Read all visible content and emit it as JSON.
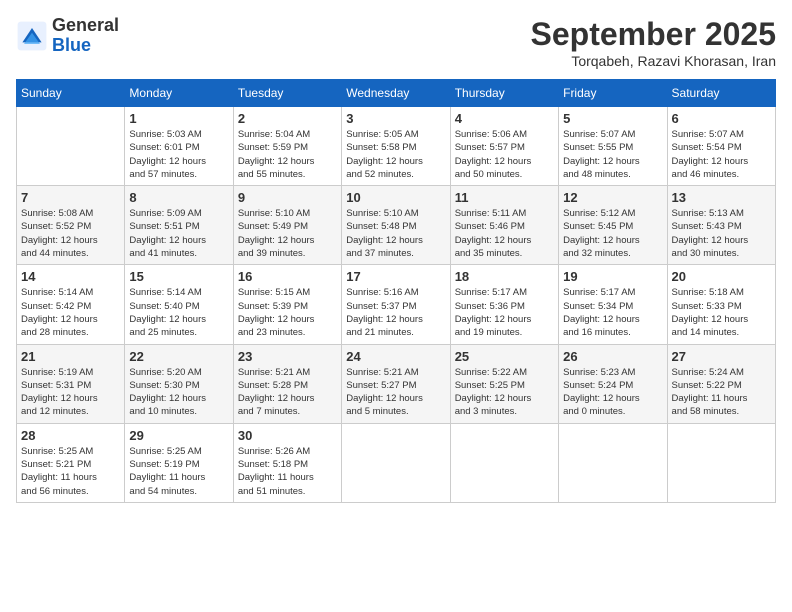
{
  "header": {
    "logo_line1": "General",
    "logo_line2": "Blue",
    "month_title": "September 2025",
    "subtitle": "Torqabeh, Razavi Khorasan, Iran"
  },
  "weekdays": [
    "Sunday",
    "Monday",
    "Tuesday",
    "Wednesday",
    "Thursday",
    "Friday",
    "Saturday"
  ],
  "weeks": [
    [
      {
        "day": "",
        "info": ""
      },
      {
        "day": "1",
        "info": "Sunrise: 5:03 AM\nSunset: 6:01 PM\nDaylight: 12 hours\nand 57 minutes."
      },
      {
        "day": "2",
        "info": "Sunrise: 5:04 AM\nSunset: 5:59 PM\nDaylight: 12 hours\nand 55 minutes."
      },
      {
        "day": "3",
        "info": "Sunrise: 5:05 AM\nSunset: 5:58 PM\nDaylight: 12 hours\nand 52 minutes."
      },
      {
        "day": "4",
        "info": "Sunrise: 5:06 AM\nSunset: 5:57 PM\nDaylight: 12 hours\nand 50 minutes."
      },
      {
        "day": "5",
        "info": "Sunrise: 5:07 AM\nSunset: 5:55 PM\nDaylight: 12 hours\nand 48 minutes."
      },
      {
        "day": "6",
        "info": "Sunrise: 5:07 AM\nSunset: 5:54 PM\nDaylight: 12 hours\nand 46 minutes."
      }
    ],
    [
      {
        "day": "7",
        "info": "Sunrise: 5:08 AM\nSunset: 5:52 PM\nDaylight: 12 hours\nand 44 minutes."
      },
      {
        "day": "8",
        "info": "Sunrise: 5:09 AM\nSunset: 5:51 PM\nDaylight: 12 hours\nand 41 minutes."
      },
      {
        "day": "9",
        "info": "Sunrise: 5:10 AM\nSunset: 5:49 PM\nDaylight: 12 hours\nand 39 minutes."
      },
      {
        "day": "10",
        "info": "Sunrise: 5:10 AM\nSunset: 5:48 PM\nDaylight: 12 hours\nand 37 minutes."
      },
      {
        "day": "11",
        "info": "Sunrise: 5:11 AM\nSunset: 5:46 PM\nDaylight: 12 hours\nand 35 minutes."
      },
      {
        "day": "12",
        "info": "Sunrise: 5:12 AM\nSunset: 5:45 PM\nDaylight: 12 hours\nand 32 minutes."
      },
      {
        "day": "13",
        "info": "Sunrise: 5:13 AM\nSunset: 5:43 PM\nDaylight: 12 hours\nand 30 minutes."
      }
    ],
    [
      {
        "day": "14",
        "info": "Sunrise: 5:14 AM\nSunset: 5:42 PM\nDaylight: 12 hours\nand 28 minutes."
      },
      {
        "day": "15",
        "info": "Sunrise: 5:14 AM\nSunset: 5:40 PM\nDaylight: 12 hours\nand 25 minutes."
      },
      {
        "day": "16",
        "info": "Sunrise: 5:15 AM\nSunset: 5:39 PM\nDaylight: 12 hours\nand 23 minutes."
      },
      {
        "day": "17",
        "info": "Sunrise: 5:16 AM\nSunset: 5:37 PM\nDaylight: 12 hours\nand 21 minutes."
      },
      {
        "day": "18",
        "info": "Sunrise: 5:17 AM\nSunset: 5:36 PM\nDaylight: 12 hours\nand 19 minutes."
      },
      {
        "day": "19",
        "info": "Sunrise: 5:17 AM\nSunset: 5:34 PM\nDaylight: 12 hours\nand 16 minutes."
      },
      {
        "day": "20",
        "info": "Sunrise: 5:18 AM\nSunset: 5:33 PM\nDaylight: 12 hours\nand 14 minutes."
      }
    ],
    [
      {
        "day": "21",
        "info": "Sunrise: 5:19 AM\nSunset: 5:31 PM\nDaylight: 12 hours\nand 12 minutes."
      },
      {
        "day": "22",
        "info": "Sunrise: 5:20 AM\nSunset: 5:30 PM\nDaylight: 12 hours\nand 10 minutes."
      },
      {
        "day": "23",
        "info": "Sunrise: 5:21 AM\nSunset: 5:28 PM\nDaylight: 12 hours\nand 7 minutes."
      },
      {
        "day": "24",
        "info": "Sunrise: 5:21 AM\nSunset: 5:27 PM\nDaylight: 12 hours\nand 5 minutes."
      },
      {
        "day": "25",
        "info": "Sunrise: 5:22 AM\nSunset: 5:25 PM\nDaylight: 12 hours\nand 3 minutes."
      },
      {
        "day": "26",
        "info": "Sunrise: 5:23 AM\nSunset: 5:24 PM\nDaylight: 12 hours\nand 0 minutes."
      },
      {
        "day": "27",
        "info": "Sunrise: 5:24 AM\nSunset: 5:22 PM\nDaylight: 11 hours\nand 58 minutes."
      }
    ],
    [
      {
        "day": "28",
        "info": "Sunrise: 5:25 AM\nSunset: 5:21 PM\nDaylight: 11 hours\nand 56 minutes."
      },
      {
        "day": "29",
        "info": "Sunrise: 5:25 AM\nSunset: 5:19 PM\nDaylight: 11 hours\nand 54 minutes."
      },
      {
        "day": "30",
        "info": "Sunrise: 5:26 AM\nSunset: 5:18 PM\nDaylight: 11 hours\nand 51 minutes."
      },
      {
        "day": "",
        "info": ""
      },
      {
        "day": "",
        "info": ""
      },
      {
        "day": "",
        "info": ""
      },
      {
        "day": "",
        "info": ""
      }
    ]
  ]
}
